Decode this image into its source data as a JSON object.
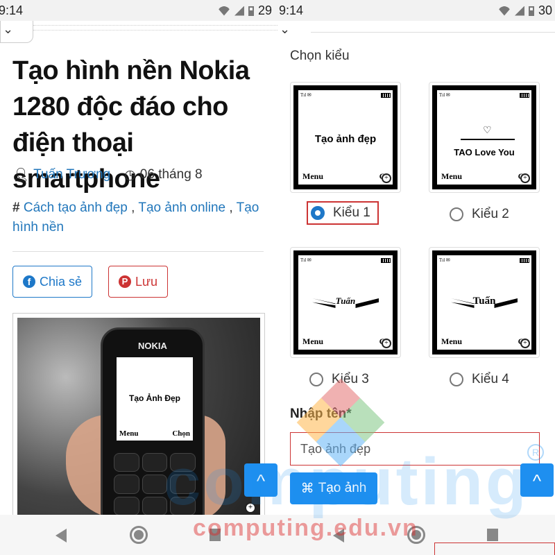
{
  "left": {
    "status": {
      "time": "9:14",
      "battery": "29"
    },
    "article": {
      "title": "Tạo hình nền Nokia 1280 độc đáo cho điện thoại smartphone",
      "author": "Tuấn Trương",
      "date": "06 tháng 8",
      "tags": [
        "Cách tạo ảnh đẹp",
        "Tạo ảnh online",
        "Tạo hình nền"
      ],
      "share_label": "Chia sẻ",
      "save_label": "Lưu",
      "photo": {
        "brand": "NOKIA",
        "screen_text": "Tạo Ảnh Đẹp",
        "menu": "Menu",
        "select": "Chọn"
      }
    },
    "scroll_up": "^"
  },
  "right": {
    "status": {
      "time": "9:14",
      "battery": "30"
    },
    "choose_label": "Chọn kiểu",
    "styles": [
      {
        "label": "Kiểu 1",
        "text": "Tạo ảnh đẹp",
        "selected": true
      },
      {
        "label": "Kiểu 2",
        "text": "TAO Love You",
        "selected": false
      },
      {
        "label": "Kiểu 3",
        "text": "Tuấn",
        "selected": false
      },
      {
        "label": "Kiểu 4",
        "text": "Tuấn",
        "selected": false
      }
    ],
    "preview": {
      "menu": "Menu",
      "select": "Ch"
    },
    "name_label": "Nhập tên*",
    "name_value": "Tạo ảnh đẹp",
    "create_label": "Tạo ảnh"
  },
  "watermark": {
    "big": "computing",
    "small": "computing.edu.vn"
  },
  "colors": {
    "accent": "#1e8ff0",
    "link": "#2277bb",
    "danger": "#cc3333"
  }
}
